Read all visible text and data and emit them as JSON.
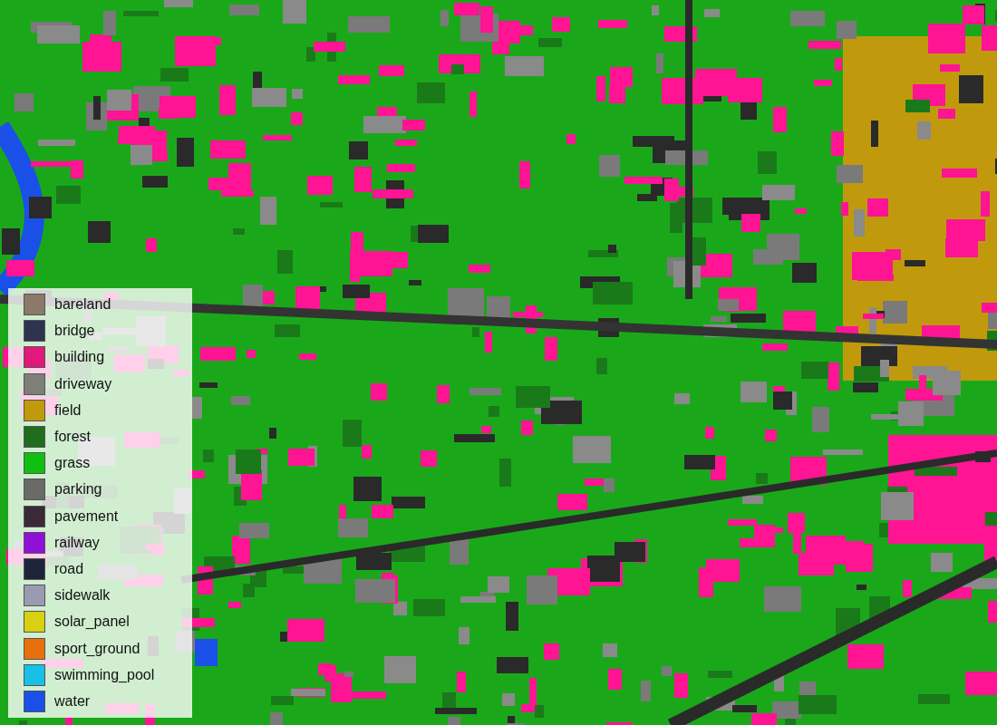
{
  "legend": {
    "items": [
      {
        "label": "bareland",
        "color": "#8b7a6a"
      },
      {
        "label": "bridge",
        "color": "#2e3350"
      },
      {
        "label": "building",
        "color": "#e0197a"
      },
      {
        "label": "driveway",
        "color": "#7f7f7a"
      },
      {
        "label": "field",
        "color": "#c09a0c"
      },
      {
        "label": "forest",
        "color": "#1e6e1e"
      },
      {
        "label": "grass",
        "color": "#10c010"
      },
      {
        "label": "parking",
        "color": "#6a6a66"
      },
      {
        "label": "pavement",
        "color": "#3a2a38"
      },
      {
        "label": "railway",
        "color": "#9010d8"
      },
      {
        "label": "road",
        "color": "#1e2438"
      },
      {
        "label": "sidewalk",
        "color": "#9a9ab0"
      },
      {
        "label": "solar_panel",
        "color": "#d8d010"
      },
      {
        "label": "sport_ground",
        "color": "#e8700c"
      },
      {
        "label": "swimming_pool",
        "color": "#18c0e8"
      },
      {
        "label": "water",
        "color": "#1a50e8"
      }
    ]
  }
}
